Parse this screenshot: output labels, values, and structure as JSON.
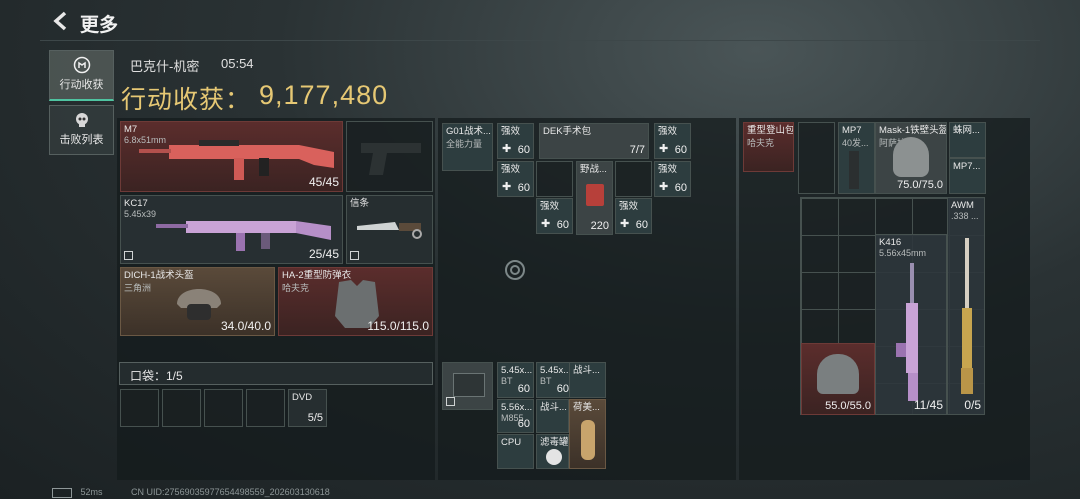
{
  "header": {
    "title": "更多",
    "back_icon": "chevron-left-icon"
  },
  "sidebar": {
    "items": [
      {
        "label": "行动收获",
        "icon": "badge-icon",
        "active": true
      },
      {
        "label": "击败列表",
        "icon": "skull-icon",
        "active": false
      }
    ]
  },
  "summary": {
    "map_name": "巴克什-机密",
    "time": "05:54",
    "haul_label": "行动收获：",
    "haul_value": "9,177,480"
  },
  "loadout": {
    "primary": {
      "name": "M7",
      "caliber": "6.8x51mm",
      "ammo": "45/45"
    },
    "secondary": {
      "name": "KC17",
      "caliber": "5.45x39",
      "ammo": "25/45"
    },
    "melee": {
      "name": "信条"
    },
    "helmet": {
      "name": "DICH-1战术头盔",
      "sub": "三角洲",
      "durability": "34.0/40.0"
    },
    "armor": {
      "name": "HA-2重型防弹衣",
      "sub": "哈夫克",
      "durability": "115.0/115.0"
    },
    "pocket": {
      "label": "口袋：1/5",
      "item": {
        "name": "DVD",
        "count": "5/5"
      }
    }
  },
  "chest_rig": {
    "items": [
      {
        "name": "G01战术...",
        "sub": "全能力量"
      },
      {
        "name": "强效",
        "count": "60"
      },
      {
        "name": "强效",
        "count": "60"
      },
      {
        "name": "DEK手术包",
        "count": "7/7"
      },
      {
        "name": "强效",
        "count": "60"
      },
      {
        "name": "强效",
        "count": "60"
      },
      {
        "name": "野战...",
        "count": "220"
      },
      {
        "name": "强效",
        "count": "60"
      },
      {
        "name": "强效",
        "count": "60"
      },
      {
        "name": "强效",
        "count": "60"
      }
    ]
  },
  "ammo_box": {
    "items": [
      {
        "name": "5.45x...",
        "sub": "BT",
        "count": "60"
      },
      {
        "name": "5.45x...",
        "sub": "BT",
        "count": "60"
      },
      {
        "name": "战斗..."
      },
      {
        "name": "5.56x...",
        "sub": "M855",
        "count": "60"
      },
      {
        "name": "战斗..."
      },
      {
        "name": "荷美..."
      },
      {
        "name": "CPU"
      },
      {
        "name": "滤毒罐"
      }
    ]
  },
  "backpack": {
    "items": [
      {
        "name": "重型登山包",
        "sub": "哈夫克"
      },
      {
        "name": "MP7",
        "sub": "40发..."
      },
      {
        "name": "Mask-1铁壁头盔",
        "sub": "阿萨拉",
        "durability": "75.0/75.0"
      },
      {
        "name": "蛛网..."
      },
      {
        "name": "MP7..."
      },
      {
        "name": "K416",
        "sub": "5.56x45mm",
        "ammo": "11/45"
      },
      {
        "name": "AWM",
        "sub": ".338 ...",
        "ammo": "0/5"
      },
      {
        "durability": "55.0/55.0"
      }
    ]
  },
  "footer": {
    "ping": "52ms",
    "uid": "CN UID:27569035977654498559_202603130618"
  },
  "colors": {
    "gold": "#e6c874",
    "teal_accent": "#4fc4a1",
    "red_item": "#5b2d2c"
  }
}
